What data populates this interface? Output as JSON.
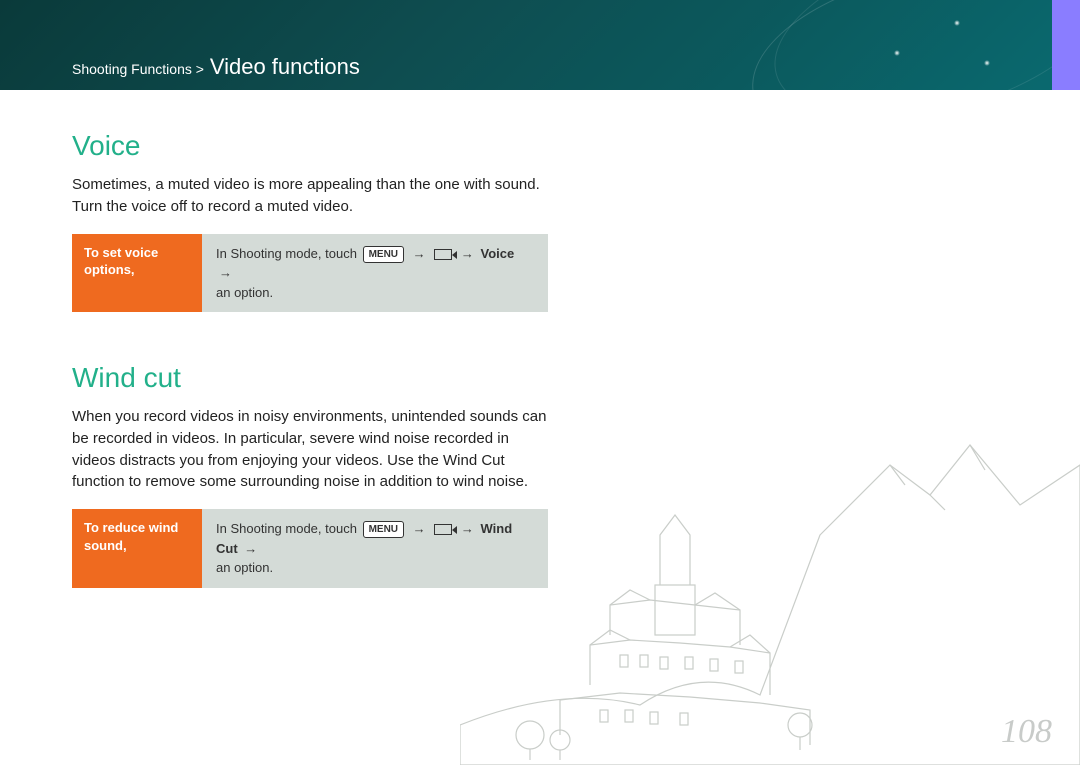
{
  "header": {
    "breadcrumb_parent": "Shooting Functions >",
    "breadcrumb_section": "Video functions"
  },
  "sections": {
    "voice": {
      "title": "Voice",
      "body": "Sometimes, a muted video is more appealing than the one with sound. Turn the voice off to record a muted video.",
      "callout_label": "To set voice options,",
      "instruction_prefix": "In Shooting mode, touch",
      "menu_label": "MENU",
      "path_bold": "Voice",
      "instruction_suffix": "an option."
    },
    "windcut": {
      "title": "Wind cut",
      "body": "When you record videos in noisy environments, unintended sounds can be recorded in videos. In particular, severe wind noise recorded in videos distracts you from enjoying your videos. Use the Wind Cut function to remove some surrounding noise in addition to wind noise.",
      "callout_label": "To reduce wind sound,",
      "instruction_prefix": "In Shooting mode, touch",
      "menu_label": "MENU",
      "path_bold": "Wind Cut",
      "instruction_suffix": "an option."
    }
  },
  "page_number": "108"
}
